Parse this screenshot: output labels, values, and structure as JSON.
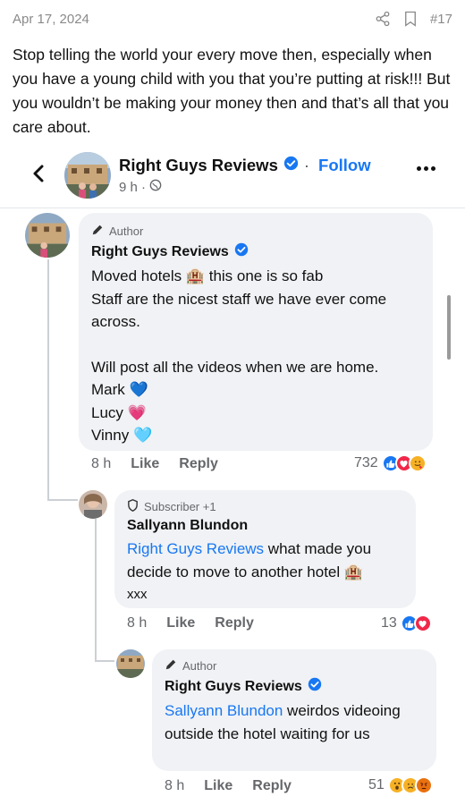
{
  "post": {
    "date": "Apr 17, 2024",
    "number": "#17",
    "text": "Stop telling the world your every move then, especially when you have a young child with you that you’re putting at risk!!! But you wouldn’t be making your money then and that’s all that you care about."
  },
  "header": {
    "page_name": "Right Guys Reviews",
    "separator": "·",
    "follow_label": "Follow",
    "time": "9 h ·"
  },
  "comments": [
    {
      "badge": "Author",
      "name": "Right Guys Reviews",
      "lines": [
        "Moved hotels 🏨 this one is so fab",
        "Staff are the nicest staff we have ever come across.",
        "",
        "Will post all the videos when we are home.",
        "Mark 💙",
        "Lucy 💗",
        "Vinny 🩵"
      ],
      "time": "8 h",
      "like": "Like",
      "reply": "Reply",
      "reaction_count": "732"
    },
    {
      "badge": "Subscriber +1",
      "name": "Sallyann Blundon",
      "mention": "Right Guys Reviews",
      "text_after_mention": " what made you decide to move to another hotel 🏨",
      "text_line2": "xxx",
      "time": "8 h",
      "like": "Like",
      "reply": "Reply",
      "reaction_count": "13"
    },
    {
      "badge": "Author",
      "name": "Right Guys Reviews",
      "mention": "Sallyann Blundon",
      "text_after_mention": " weirdos videoing outside the hotel waiting for us",
      "time": "8 h",
      "like": "Like",
      "reply": "Reply",
      "reaction_count": "51"
    }
  ],
  "colors": {
    "accent": "#1877f2",
    "bubble": "#f0f2f5",
    "muted": "#65676b",
    "love": "#f02849",
    "haha": "#f7b125"
  }
}
